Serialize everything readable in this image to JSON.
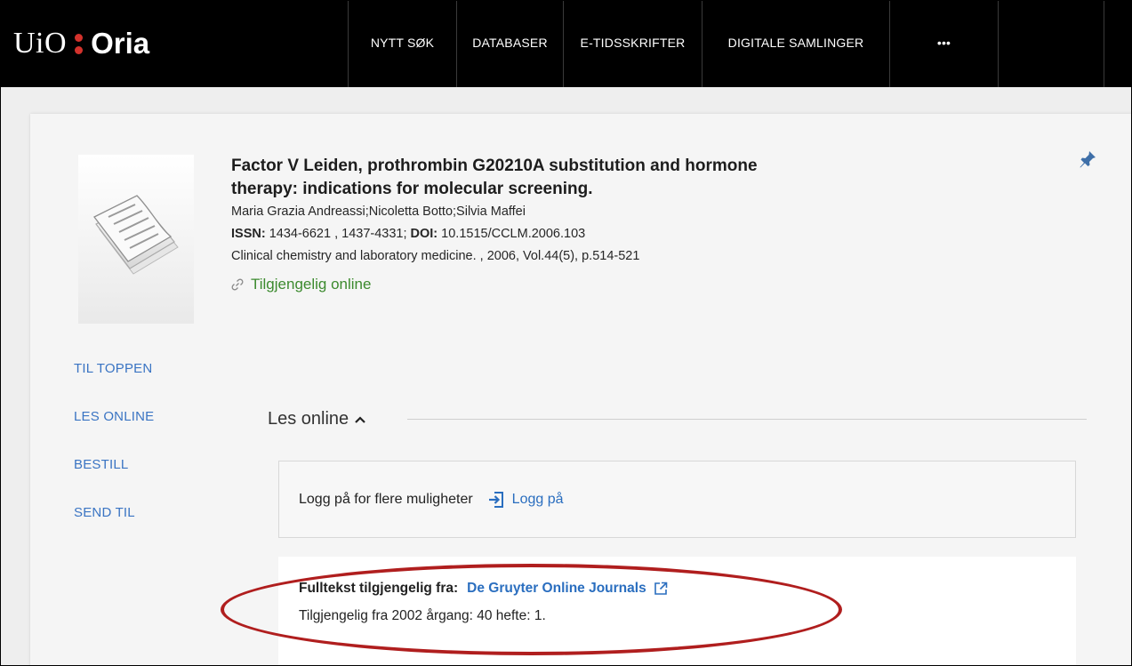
{
  "header": {
    "logo_uio": "UiO",
    "logo_oria": "Oria",
    "nav": [
      "NYTT SØK",
      "DATABASER",
      "E-TIDSSKRIFTER",
      "DIGITALE SAMLINGER",
      "•••"
    ]
  },
  "record": {
    "title": "Factor V Leiden, prothrombin G20210A substitution and hormone therapy: indications for molecular screening.",
    "authors": "Maria Grazia Andreassi;Nicoletta Botto;Silvia Maffei",
    "issn_label": "ISSN:",
    "issn_value": " 1434-6621 , 1437-4331; ",
    "doi_label": "DOI:",
    "doi_value": " 10.1515/CCLM.2006.103",
    "source": "Clinical chemistry and laboratory medicine. , 2006, Vol.44(5), p.514-521",
    "availability": "Tilgjengelig online"
  },
  "sidenav": [
    "TIL TOPPEN",
    "LES ONLINE",
    "BESTILL",
    "SEND TIL"
  ],
  "les_online": {
    "title": "Les online",
    "login_prompt": "Logg på for flere muligheter",
    "login_button": "Logg på",
    "fulltext_label": "Fulltekst tilgjengelig fra:",
    "fulltext_source": "De Gruyter Online Journals",
    "coverage": "Tilgjengelig fra 2002 årgang: 40 hefte: 1."
  },
  "colors": {
    "accent_link": "#2a6ebf",
    "available_green": "#3c8a2e",
    "logo_dots": "#d3322c",
    "annotation_ellipse": "#b01e1e"
  }
}
